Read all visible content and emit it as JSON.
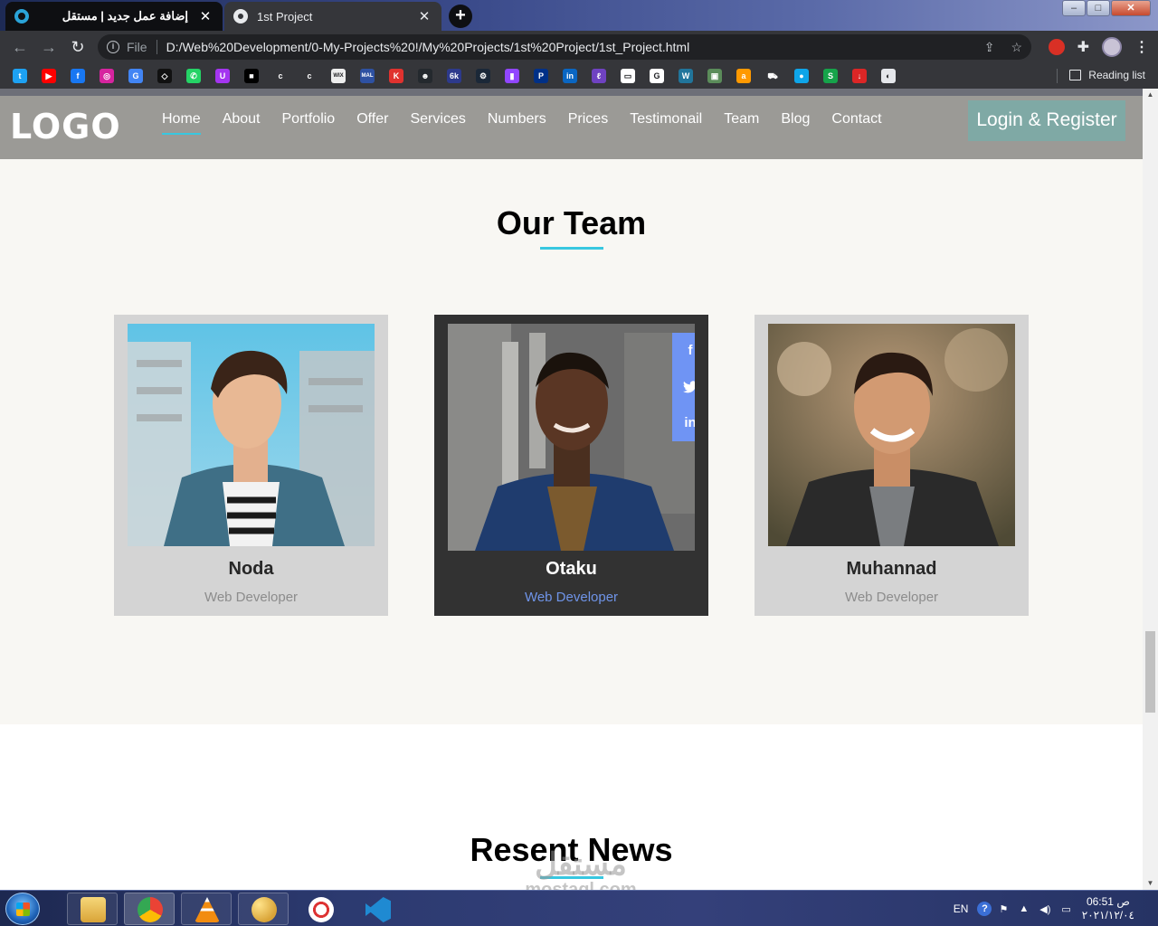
{
  "browser": {
    "tabs": [
      {
        "title": "إضافة عمل جديد | مستقل",
        "close": "✕"
      },
      {
        "title": "1st Project",
        "close": "✕"
      }
    ],
    "new_tab": "+",
    "window_buttons": {
      "minimize": "–",
      "maximize": "□",
      "close": "✕"
    },
    "nav": {
      "back": "←",
      "forward": "→",
      "reload": "↻"
    },
    "omnibox": {
      "info": "i",
      "scheme_label": "File",
      "url": "D:/Web%20Development/0-My-Projects%20!/My%20Projects/1st%20Project/1st_Project.html",
      "share": "⇪",
      "star": "☆"
    },
    "toolbar_icons": {
      "extensions": "✚",
      "menu": "⋮"
    },
    "bookmarks": [
      {
        "icon": "twitter-icon",
        "glyph": "t",
        "color": "#1da1f2"
      },
      {
        "icon": "youtube-icon",
        "glyph": "▶",
        "color": "#ff0000"
      },
      {
        "icon": "facebook-icon",
        "glyph": "f",
        "color": "#1877f2"
      },
      {
        "icon": "instagram-icon",
        "glyph": "◎",
        "color": "#d6249f"
      },
      {
        "icon": "translate-icon",
        "glyph": "G",
        "color": "#4285f4"
      },
      {
        "icon": "codepen-icon",
        "glyph": "◇",
        "color": "#111111"
      },
      {
        "icon": "whatsapp-icon",
        "glyph": "✆",
        "color": "#25d366"
      },
      {
        "icon": "udemy-icon",
        "glyph": "U",
        "color": "#a435f0"
      },
      {
        "icon": "bookmark-icon",
        "glyph": "■",
        "color": "#000000"
      },
      {
        "icon": "c-icon",
        "glyph": "c",
        "color": "#35363a"
      },
      {
        "icon": "c2-icon",
        "glyph": "c",
        "color": "#35363a"
      },
      {
        "icon": "wix-icon",
        "glyph": "WIX",
        "color": "#eeeeee"
      },
      {
        "icon": "mal-icon",
        "glyph": "MAL",
        "color": "#2e51a2"
      },
      {
        "icon": "k-icon",
        "glyph": "K",
        "color": "#e0322f"
      },
      {
        "icon": "github-icon",
        "glyph": "☻",
        "color": "#24292e"
      },
      {
        "icon": "6k-icon",
        "glyph": "6k",
        "color": "#2d3a8c"
      },
      {
        "icon": "steam-icon",
        "glyph": "⚙",
        "color": "#1b2838"
      },
      {
        "icon": "twitch-icon",
        "glyph": "▮",
        "color": "#9146ff"
      },
      {
        "icon": "paypal-icon",
        "glyph": "P",
        "color": "#003087"
      },
      {
        "icon": "linkedin-icon",
        "glyph": "in",
        "color": "#0a66c2"
      },
      {
        "icon": "feather-icon",
        "glyph": "ℓ",
        "color": "#6f42c1"
      },
      {
        "icon": "site-icon",
        "glyph": "▭",
        "color": "#ffffff"
      },
      {
        "icon": "google-icon",
        "glyph": "G",
        "color": "#ffffff"
      },
      {
        "icon": "wordpress-icon",
        "glyph": "W",
        "color": "#21759b"
      },
      {
        "icon": "image-icon",
        "glyph": "▣",
        "color": "#5b8c5a"
      },
      {
        "icon": "amazon-icon",
        "glyph": "a",
        "color": "#ff9900"
      },
      {
        "icon": "cart-icon",
        "glyph": "⛟",
        "color": "#35363a"
      },
      {
        "icon": "circle-icon",
        "glyph": "●",
        "color": "#0ea5e9"
      },
      {
        "icon": "s-icon",
        "glyph": "S",
        "color": "#16a34a"
      },
      {
        "icon": "download-icon",
        "glyph": "↓",
        "color": "#dc2626"
      },
      {
        "icon": "globe-icon",
        "glyph": "◐",
        "color": "#e5e7eb"
      }
    ],
    "reading_list": "Reading list"
  },
  "site": {
    "logo": "LOGO",
    "nav": [
      "Home",
      "About",
      "Portfolio",
      "Offer",
      "Services",
      "Numbers",
      "Prices",
      "Testimonail",
      "Team",
      "Blog",
      "Contact"
    ],
    "active_nav": "Home",
    "login_label": "Login & Register",
    "team": {
      "title": "Our Team",
      "members": [
        {
          "name": "Noda",
          "role": "Web Developer"
        },
        {
          "name": "Otaku",
          "role": "Web Developer",
          "featured": true
        },
        {
          "name": "Muhannad",
          "role": "Web Developer"
        }
      ],
      "social": {
        "facebook": "f",
        "twitter": "🐦",
        "linkedin": "in"
      }
    },
    "news": {
      "title": "Resent News"
    }
  },
  "watermark": {
    "arabic": "مستقل",
    "latin": "mostaql.com"
  },
  "scrollbar": {
    "up": "▲",
    "down": "▼"
  },
  "taskbar": {
    "apps": [
      "explorer-icon",
      "chrome-icon",
      "vlc-icon",
      "paint-icon",
      "snipping-tool-icon",
      "vscode-icon"
    ],
    "tray": {
      "lang": "EN",
      "help": "?",
      "time": "06:51 ص",
      "date": "٢٠٢١/١٢/٠٤"
    }
  },
  "colors": {
    "accent": "#38c7e0",
    "header": "#9b9a96",
    "social": "#6f94f4",
    "featured_role": "#6f94e8"
  }
}
